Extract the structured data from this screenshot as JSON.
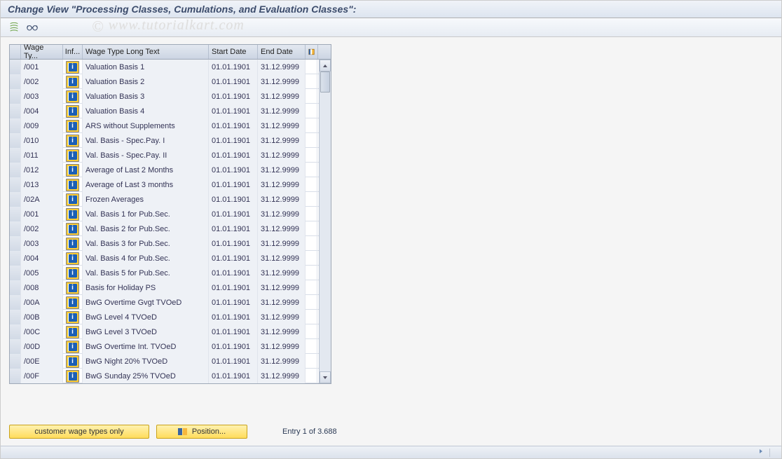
{
  "title": "Change View \"Processing Classes, Cumulations, and Evaluation Classes\":",
  "watermark": "© www.tutorialkart.com",
  "toolbar": {
    "btn1_name": "other-view",
    "btn2_name": "display-change"
  },
  "columns": {
    "wage_type": "Wage Ty...",
    "info": "Inf...",
    "long_text": "Wage Type Long Text",
    "start": "Start Date",
    "end": "End Date"
  },
  "rows": [
    {
      "wt": "/001",
      "txt": "Valuation Basis 1",
      "sd": "01.01.1901",
      "ed": "31.12.9999"
    },
    {
      "wt": "/002",
      "txt": "Valuation Basis 2",
      "sd": "01.01.1901",
      "ed": "31.12.9999"
    },
    {
      "wt": "/003",
      "txt": "Valuation Basis 3",
      "sd": "01.01.1901",
      "ed": "31.12.9999"
    },
    {
      "wt": "/004",
      "txt": "Valuation Basis 4",
      "sd": "01.01.1901",
      "ed": "31.12.9999"
    },
    {
      "wt": "/009",
      "txt": "ARS without Supplements",
      "sd": "01.01.1901",
      "ed": "31.12.9999"
    },
    {
      "wt": "/010",
      "txt": "Val. Basis - Spec.Pay. I",
      "sd": "01.01.1901",
      "ed": "31.12.9999"
    },
    {
      "wt": "/011",
      "txt": "Val. Basis - Spec.Pay. II",
      "sd": "01.01.1901",
      "ed": "31.12.9999"
    },
    {
      "wt": "/012",
      "txt": "Average of Last 2 Months",
      "sd": "01.01.1901",
      "ed": "31.12.9999"
    },
    {
      "wt": "/013",
      "txt": "Average of Last 3 months",
      "sd": "01.01.1901",
      "ed": "31.12.9999"
    },
    {
      "wt": "/02A",
      "txt": "Frozen Averages",
      "sd": "01.01.1901",
      "ed": "31.12.9999"
    },
    {
      "wt": "/001",
      "txt": "Val. Basis 1 for Pub.Sec.",
      "sd": "01.01.1901",
      "ed": "31.12.9999"
    },
    {
      "wt": "/002",
      "txt": "Val. Basis 2 for Pub.Sec.",
      "sd": "01.01.1901",
      "ed": "31.12.9999"
    },
    {
      "wt": "/003",
      "txt": "Val. Basis 3 for Pub.Sec.",
      "sd": "01.01.1901",
      "ed": "31.12.9999"
    },
    {
      "wt": "/004",
      "txt": "Val. Basis 4 for Pub.Sec.",
      "sd": "01.01.1901",
      "ed": "31.12.9999"
    },
    {
      "wt": "/005",
      "txt": "Val. Basis 5 for Pub.Sec.",
      "sd": "01.01.1901",
      "ed": "31.12.9999"
    },
    {
      "wt": "/008",
      "txt": "Basis for Holiday PS",
      "sd": "01.01.1901",
      "ed": "31.12.9999"
    },
    {
      "wt": "/00A",
      "txt": "BwG Overtime Gvgt TVOeD",
      "sd": "01.01.1901",
      "ed": "31.12.9999"
    },
    {
      "wt": "/00B",
      "txt": "BwG Level 4 TVOeD",
      "sd": "01.01.1901",
      "ed": "31.12.9999"
    },
    {
      "wt": "/00C",
      "txt": "BwG Level 3 TVOeD",
      "sd": "01.01.1901",
      "ed": "31.12.9999"
    },
    {
      "wt": "/00D",
      "txt": "BwG Overtime Int. TVOeD",
      "sd": "01.01.1901",
      "ed": "31.12.9999"
    },
    {
      "wt": "/00E",
      "txt": "BwG Night 20% TVOeD",
      "sd": "01.01.1901",
      "ed": "31.12.9999"
    },
    {
      "wt": "/00F",
      "txt": "BwG Sunday 25% TVOeD",
      "sd": "01.01.1901",
      "ed": "31.12.9999"
    }
  ],
  "buttons": {
    "customer_only": "customer wage types only",
    "position": "Position..."
  },
  "entry_text": "Entry 1 of 3.688",
  "status": {
    "right": ""
  }
}
